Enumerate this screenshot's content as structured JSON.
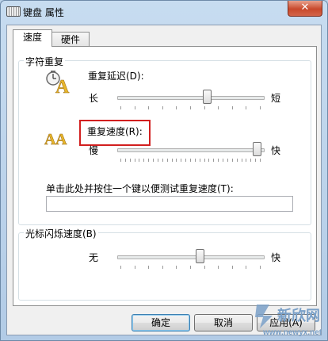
{
  "window": {
    "title": "键盘 属性",
    "close_label": "✕"
  },
  "tabs": [
    {
      "label": "速度",
      "active": true
    },
    {
      "label": "硬件",
      "active": false
    }
  ],
  "char_repeat": {
    "group_title": "字符重复",
    "delay": {
      "label": "重复延迟(D):",
      "min_label": "长",
      "max_label": "短",
      "value_fraction": 0.62
    },
    "rate": {
      "label": "重复速度(R):",
      "min_label": "慢",
      "max_label": "快",
      "value_fraction": 0.98
    },
    "test": {
      "label": "单击此处并按住一个键以便测试重复速度(T):",
      "value": ""
    }
  },
  "cursor_blink": {
    "group_title": "光标闪烁速度(B)",
    "min_label": "无",
    "max_label": "快",
    "value_fraction": 0.57
  },
  "buttons": {
    "ok": "确定",
    "cancel": "取消",
    "apply": "应用(A)"
  },
  "watermark": {
    "line1": "新欣网",
    "line2": "www.newyx.net"
  },
  "colors": {
    "highlight": "#d21f1f",
    "title_bar": "#b9d1ea"
  }
}
